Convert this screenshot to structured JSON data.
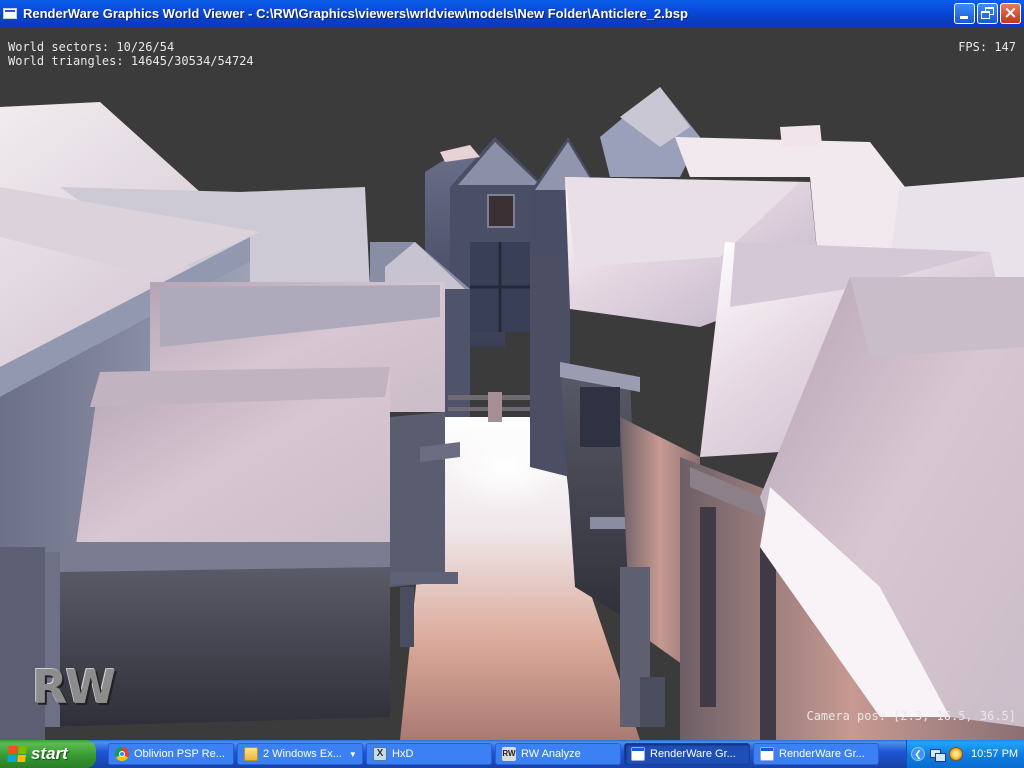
{
  "window": {
    "title": "RenderWare Graphics World Viewer - C:\\RW\\Graphics\\viewers\\wrldview\\models\\New Folder\\Anticlere_2.bsp",
    "buttons": [
      "minimize",
      "restore",
      "close"
    ]
  },
  "hud": {
    "sectors": "World sectors: 10/26/54",
    "triangles": "World triangles: 14645/30534/54724",
    "fps": "FPS: 147",
    "camera": "Camera pos: [2.3, 16.5, 36.5]"
  },
  "logo": {
    "text": "RW"
  },
  "taskbar": {
    "start_label": "start",
    "tasks": [
      {
        "label": "Oblivion PSP Re...",
        "icon": "chrome-icon"
      },
      {
        "label": "2 Windows Ex...",
        "icon": "folder-icon"
      },
      {
        "label": "HxD",
        "icon": "hxd-icon"
      },
      {
        "label": "RW Analyze",
        "icon": "rw-icon",
        "icon_text": "RW"
      },
      {
        "label": "RenderWare Gr...",
        "icon": "window-icon"
      },
      {
        "label": "RenderWare Gr...",
        "icon": "window-icon"
      }
    ],
    "clock": "10:57 PM"
  },
  "colors": {
    "sky": "#3b3b3b",
    "titlebar": "#0a4ee0",
    "taskbar": "#2157d7",
    "start": "#379a34"
  }
}
